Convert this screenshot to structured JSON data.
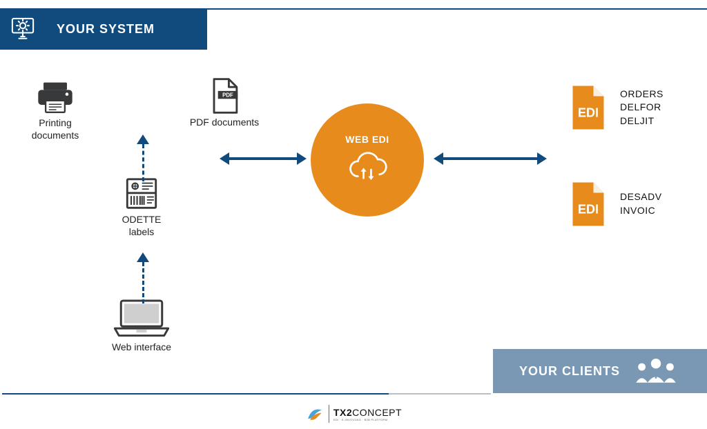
{
  "header": {
    "your_system": "YOUR SYSTEM"
  },
  "footer": {
    "your_clients": "YOUR CLIENTS"
  },
  "node": {
    "printing": "Printing\ndocuments",
    "pdf": "PDF documents",
    "odette": "ODETTE labels",
    "web": "Web interface"
  },
  "center": {
    "label": "WEB EDI"
  },
  "edi": {
    "badge": "EDI",
    "top": {
      "line1": "ORDERS",
      "line2": "DELFOR",
      "line3": "DELJIT"
    },
    "bottom": {
      "line1": "DESADV",
      "line2": "INVOIC"
    }
  },
  "brand": {
    "text_bold": "TX2",
    "text_light": "CONCEPT",
    "sub": "EDI · E-INVOICING · B2B PLATFORM"
  },
  "colors": {
    "primary": "#114b7e",
    "accent": "#e88b1d",
    "muted": "#7a98b3",
    "ink": "#38393a"
  }
}
